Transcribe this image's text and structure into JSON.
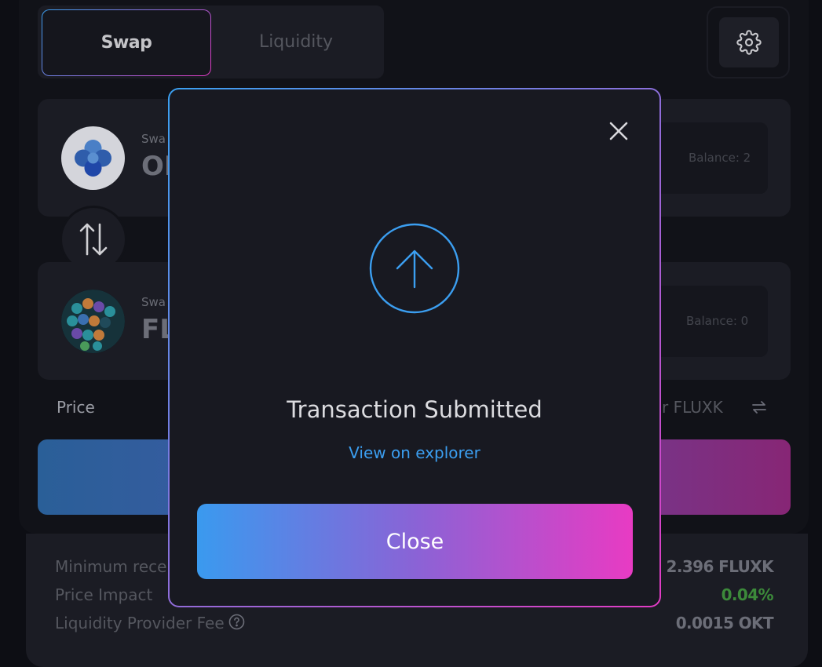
{
  "tabs": {
    "swap": "Swap",
    "liquidity": "Liquidity"
  },
  "from_card": {
    "label": "Swa",
    "symbol": "OI",
    "balance": "Balance: 2"
  },
  "to_card": {
    "label": "Swa",
    "symbol": "FL",
    "balance": "Balance: 0"
  },
  "price": {
    "label": "Price",
    "value": "per FLUXK"
  },
  "details": {
    "minimum_received": {
      "label": "Minimum recei",
      "value": "2.396 FLUXK"
    },
    "price_impact": {
      "label": "Price Impact",
      "value": "0.04%"
    },
    "lp_fee": {
      "label": "Liquidity Provider Fee",
      "value": "0.0015 OKT"
    }
  },
  "modal": {
    "title": "Transaction Submitted",
    "link": "View on explorer",
    "close_button": "Close"
  },
  "colors": {
    "accent_blue": "#3b9ef0",
    "accent_pink": "#e83bc3",
    "positive_green": "#3c8a3a",
    "modal_bg": "#181921"
  },
  "icons": {
    "settings": "gear-icon",
    "switch": "swap-arrows-icon",
    "refresh": "refresh-icon",
    "close": "close-icon",
    "submitted": "arrow-up-circle-icon",
    "help": "question-circle-icon"
  }
}
